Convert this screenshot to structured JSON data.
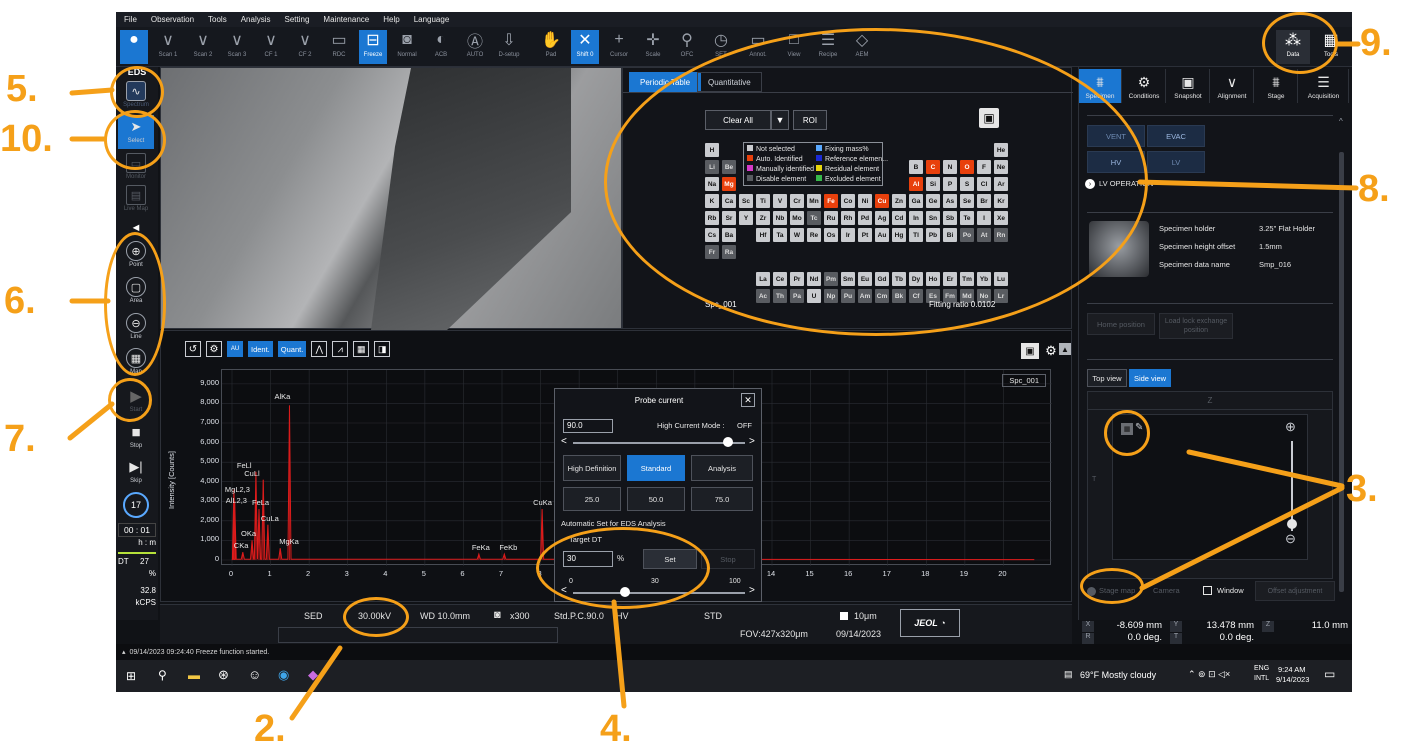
{
  "menu": [
    "File",
    "Observation",
    "Tools",
    "Analysis",
    "Setting",
    "Maintenance",
    "Help",
    "Language"
  ],
  "toolbar": [
    {
      "label": "",
      "icon": "circle-icon",
      "active": true
    },
    {
      "label": "Scan 1",
      "icon": "chevron-down-icon"
    },
    {
      "label": "Scan 2",
      "icon": "chevron-down-icon"
    },
    {
      "label": "Scan 3",
      "icon": "chevron-down-icon"
    },
    {
      "label": "CF 1",
      "icon": "chevron-down-icon"
    },
    {
      "label": "CF 2",
      "icon": "chevron-down-icon"
    },
    {
      "label": "RDC",
      "icon": "rdc-icon"
    },
    {
      "label": "Freeze",
      "icon": "freeze-icon",
      "active": true
    },
    {
      "label": "Normal",
      "icon": "camera-icon"
    },
    {
      "label": "ACB",
      "icon": "contrast-icon"
    },
    {
      "label": "AUTO",
      "icon": "auto-icon"
    },
    {
      "label": "D-setup",
      "icon": "setup-icon"
    },
    {
      "label": "Pad",
      "icon": "hand-icon"
    },
    {
      "label": "Shift 0",
      "icon": "shift-icon",
      "active": true
    },
    {
      "label": "Cursor",
      "icon": "crosshair-icon"
    },
    {
      "label": "Scale",
      "icon": "scale-icon"
    },
    {
      "label": "OFC",
      "icon": "ofc-icon"
    },
    {
      "label": "SET",
      "icon": "set-icon"
    },
    {
      "label": "Annot.",
      "icon": "annotation-icon"
    },
    {
      "label": "View",
      "icon": "view-icon"
    },
    {
      "label": "Recipe",
      "icon": "recipe-icon"
    },
    {
      "label": "AEM",
      "icon": "aem-icon"
    }
  ],
  "toolbar_right": {
    "data": "Data",
    "tools": "Tools"
  },
  "left_tools": {
    "eds": "EDS",
    "spectrum": "Spectrum",
    "select": "Select",
    "monitor": "Monitor",
    "livemap": "Live Map",
    "point": "Point",
    "area": "Area",
    "line": "Line",
    "map": "Map",
    "start": "Start",
    "stop": "Stop",
    "skip": "Skip",
    "counter": "17",
    "time": "00 : 01",
    "time_unit": "h : m",
    "dt_label": "DT",
    "dt_value": "27",
    "dt_unit": "%",
    "kcps_value": "32.8",
    "kcps_unit": "kCPS"
  },
  "eds_panel": {
    "tabs": [
      "Periodic Table",
      "Quantitative"
    ],
    "clear_all": "Clear All",
    "roi": "ROI",
    "legend": [
      {
        "text": "Not selected",
        "color": "#c9cbcf"
      },
      {
        "text": "Auto. Identified",
        "color": "#e8400c"
      },
      {
        "text": "Manually identified",
        "color": "#d63ac7"
      },
      {
        "text": "Disable element",
        "color": "#595c61"
      },
      {
        "text": "Fixing mass%",
        "color": "#5aa9ff"
      },
      {
        "text": "Reference elemen...",
        "color": "#1a2ad6"
      },
      {
        "text": "Residual element",
        "color": "#e8d70c"
      },
      {
        "text": "Excluded element",
        "color": "#37b84a"
      }
    ],
    "spc": "Spc_001",
    "fitting": "Fitting ratio 0.0102"
  },
  "spectrum": {
    "toolbar": {
      "ident": "Ident.",
      "quant": "Quant."
    },
    "spc_label": "Spc_001",
    "ylabel": "Intensity [Counts]",
    "yticks": [
      "9,000",
      "8,000",
      "7,000",
      "6,000",
      "5,000",
      "4,000",
      "3,000",
      "2,000",
      "1,000",
      "0"
    ],
    "xticks": [
      "0",
      "1",
      "2",
      "3",
      "4",
      "5",
      "6",
      "7",
      "8",
      "9",
      "10",
      "11",
      "12",
      "13",
      "14",
      "15",
      "16",
      "17",
      "18",
      "19",
      "20"
    ],
    "peaks": [
      {
        "label": "AlKa",
        "x": 1.49,
        "counts": 7900
      },
      {
        "label": "FeLl",
        "x": 0.62,
        "counts": 4500
      },
      {
        "label": "CuLl",
        "x": 0.81,
        "counts": 4100
      },
      {
        "label": "MgL2,3",
        "x": 0.05,
        "counts": 3600
      },
      {
        "label": "AlL2,3",
        "x": 0.07,
        "counts": 3000
      },
      {
        "label": "FeLa",
        "x": 0.7,
        "counts": 2600
      },
      {
        "label": "CuLa",
        "x": 0.93,
        "counts": 1800
      },
      {
        "label": "OKa",
        "x": 0.52,
        "counts": 1000
      },
      {
        "label": "CKa",
        "x": 0.28,
        "counts": 400
      },
      {
        "label": "MgKa",
        "x": 1.25,
        "counts": 600
      },
      {
        "label": "FeKa",
        "x": 6.4,
        "counts": 300
      },
      {
        "label": "FeKb",
        "x": 7.06,
        "counts": 300
      },
      {
        "label": "CuKa",
        "x": 8.04,
        "counts": 2600
      }
    ]
  },
  "probe": {
    "title": "Probe current",
    "value": "90.0",
    "high_current_label": "High Current Mode :",
    "high_current_state": "OFF",
    "modes": [
      "High Definition",
      "Standard",
      "Analysis"
    ],
    "presets": [
      "25.0",
      "50.0",
      "75.0"
    ],
    "auto_set": "Automatic Set for EDS Analysis",
    "target_dt": "Target DT",
    "target_value": "30",
    "pct": "%",
    "set": "Set",
    "stop": "Stop",
    "slider_min": "0",
    "slider_mid": "30",
    "slider_max": "100",
    "slider_value": 30
  },
  "status": {
    "sed": "SED",
    "kv": "30.00kV",
    "wd": "WD 10.0mm",
    "mag": "x300",
    "probe": "Std.P.C.90.0",
    "hv": "HV",
    "std": "STD",
    "scale": "10μm",
    "fov": "FOV:427x320μm",
    "date": "09/14/2023",
    "logo": "JEOL"
  },
  "right": {
    "tabs": [
      "Specimen",
      "Conditions",
      "Snapshot",
      "Alignment",
      "Stage",
      "Acquisition"
    ],
    "vent": "VENT",
    "evac": "EVAC",
    "hv": "HV",
    "lv": "LV",
    "lv_op": "LV OPERATION",
    "holder_label": "Specimen holder",
    "holder_value": "3.25\" Flat Holder",
    "height_label": "Specimen height offset",
    "height_value": "1.5mm",
    "name_label": "Specimen data name",
    "name_value": "Smp_016",
    "home": "Home position",
    "loadlock": "Load lock exchange position",
    "views": [
      "Top view",
      "Side view"
    ],
    "z": "Z",
    "t": "T",
    "stage_map": "Stage map",
    "camera": "Camera",
    "window": "Window",
    "offset": "Offset adjustment"
  },
  "coords": {
    "x_label": "X",
    "x": "-8.609 mm",
    "y_label": "Y",
    "y": "13.478 mm",
    "z_label": "Z",
    "z": "11.0 mm",
    "r_label": "R",
    "r": "0.0 deg.",
    "t_label": "T",
    "t": "0.0 deg."
  },
  "log": "09/14/2023 09:24:40 Freeze function started.",
  "taskbar": {
    "weather": "69°F  Mostly cloudy",
    "lang1": "ENG",
    "lang2": "INTL",
    "time": "9:24 AM",
    "date": "9/14/2023"
  },
  "callouts": [
    "2.",
    "3.",
    "4.",
    "5.",
    "6.",
    "7.",
    "8.",
    "9.",
    "10."
  ]
}
